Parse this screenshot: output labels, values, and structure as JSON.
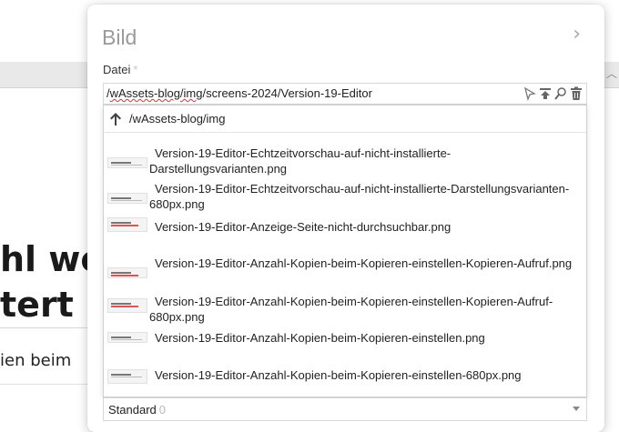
{
  "background": {
    "heading_line1": "hl we",
    "heading_line2": "tert",
    "text_line": "ien beim"
  },
  "panel": {
    "title": "Bild",
    "close_icon": "chevron-right-icon"
  },
  "file_field": {
    "label": "Datei",
    "required_marker": "*",
    "value_prefix": "/",
    "value_spell": "wAssets-blog/img",
    "value_rest": "/screens-2024/Version-19-Editor",
    "icons": [
      "cursor-select-icon",
      "upload-icon",
      "search-icon",
      "trash-icon"
    ]
  },
  "dropdown": {
    "up_path": "/wAssets-blog/img",
    "items": [
      {
        "name": "Version-19-Editor-Echtzeitvorschau-auf-nicht-installierte-Darstellungsvarianten.png"
      },
      {
        "name": "Version-19-Editor-Echtzeitvorschau-auf-nicht-installierte-Darstellungsvarianten-680px.png"
      },
      {
        "name": "Version-19-Editor-Anzeige-Seite-nicht-durchsuchbar.png"
      },
      {
        "name": "Version-19-Editor-Anzahl-Kopien-beim-Kopieren-einstellen-Kopieren-Aufruf.png"
      },
      {
        "name": "Version-19-Editor-Anzahl-Kopien-beim-Kopieren-einstellen-Kopieren-Aufruf-680px.png"
      },
      {
        "name": "Version-19-Editor-Anzahl-Kopien-beim-Kopieren-einstellen.png"
      },
      {
        "name": "Version-19-Editor-Anzahl-Kopien-beim-Kopieren-einstellen-680px.png"
      }
    ]
  },
  "standard_select": {
    "value": "Standard",
    "count": "0"
  },
  "colors": {
    "panel_bg": "#ffffff",
    "title": "#9a9a9a",
    "spellcheck_underline": "#dd3333"
  }
}
